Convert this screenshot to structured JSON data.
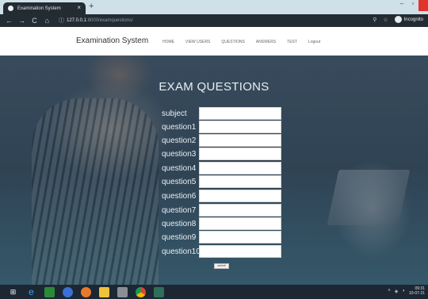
{
  "browser": {
    "tab_title": "Examination System",
    "tab_close": "×",
    "new_tab": "+",
    "url_host": "127.0.0.1",
    "url_path": ":8000/examquestions/",
    "profile_label": "Incognito",
    "nav_back": "←",
    "nav_forward": "→",
    "nav_reload": "C",
    "nav_home": "⌂"
  },
  "site": {
    "brand": "Examination System",
    "menu": [
      "HOME",
      "VIEW USERS",
      "QUESTIONS",
      "ANSWERS",
      "TEST",
      "Logout"
    ]
  },
  "form": {
    "title": "EXAM QUESTIONS",
    "fields": [
      "subject",
      "question1",
      "question2",
      "question3",
      "question4",
      "question5",
      "question6",
      "question7",
      "question8",
      "question9",
      "question10"
    ],
    "submit_label": "submit"
  },
  "taskbar": {
    "time": "09:31",
    "date": "10-07-21"
  },
  "colors": {
    "accent_close": "#e0342c",
    "chrome_dark": "#232b33",
    "tab_strip": "#cfe0e9"
  }
}
